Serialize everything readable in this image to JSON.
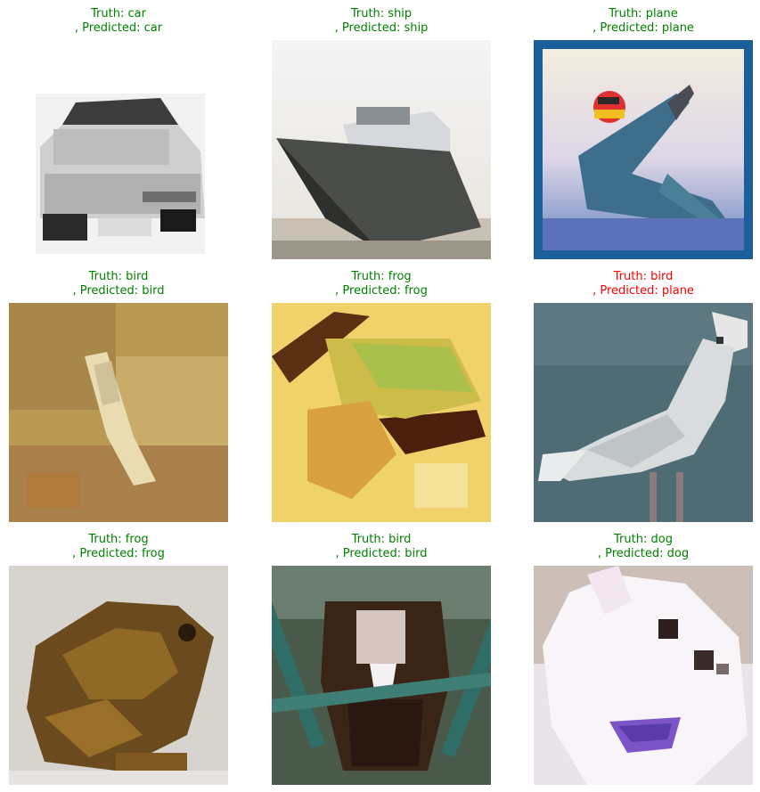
{
  "colors": {
    "correct": "#008000",
    "wrong": "#ff0000"
  },
  "panels": [
    {
      "truth_line": "Truth: car",
      "pred_line": ", Predicted: car",
      "correct": true,
      "image": "car-photo"
    },
    {
      "truth_line": "Truth: ship",
      "pred_line": ", Predicted: ship",
      "correct": true,
      "image": "ship-photo"
    },
    {
      "truth_line": "Truth: plane",
      "pred_line": ", Predicted: plane",
      "correct": true,
      "image": "plane-photo"
    },
    {
      "truth_line": "Truth: bird",
      "pred_line": ", Predicted: bird",
      "correct": true,
      "image": "bird-photo"
    },
    {
      "truth_line": "Truth: frog",
      "pred_line": ", Predicted: frog",
      "correct": true,
      "image": "frog-photo"
    },
    {
      "truth_line": "Truth: bird",
      "pred_line": ", Predicted: plane",
      "correct": false,
      "image": "seagull-photo"
    },
    {
      "truth_line": "Truth: frog",
      "pred_line": ", Predicted: frog",
      "correct": true,
      "image": "toad-photo"
    },
    {
      "truth_line": "Truth: bird",
      "pred_line": ", Predicted: bird",
      "correct": true,
      "image": "bird-in-cage-photo"
    },
    {
      "truth_line": "Truth: dog",
      "pred_line": ", Predicted: dog",
      "correct": true,
      "image": "dog-photo"
    }
  ]
}
